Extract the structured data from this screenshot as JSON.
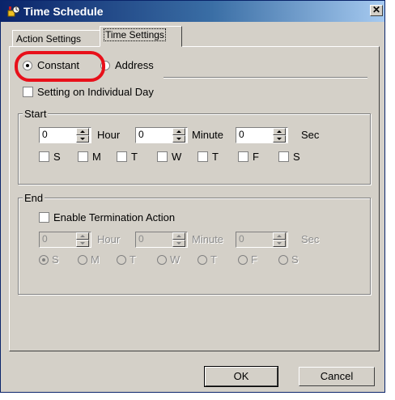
{
  "window": {
    "title": "Time Schedule",
    "close_glyph": "✕"
  },
  "tabs": [
    {
      "label": "Action Settings"
    },
    {
      "label": "Time Settings"
    }
  ],
  "mode": {
    "constant_label": "Constant",
    "address_label": "Address",
    "selected": "Constant"
  },
  "individual_day": {
    "label": "Setting on Individual Day",
    "checked": false
  },
  "start": {
    "group_label": "Start",
    "hour_value": "0",
    "hour_label": "Hour",
    "minute_value": "0",
    "minute_label": "Minute",
    "sec_value": "0",
    "sec_label": "Sec",
    "days": [
      "S",
      "M",
      "T",
      "W",
      "T",
      "F",
      "S"
    ]
  },
  "end": {
    "group_label": "End",
    "enable_label": "Enable Termination Action",
    "enable_checked": false,
    "hour_value": "0",
    "hour_label": "Hour",
    "minute_value": "0",
    "minute_label": "Minute",
    "sec_value": "0",
    "sec_label": "Sec",
    "days": [
      "S",
      "M",
      "T",
      "W",
      "T",
      "F",
      "S"
    ],
    "selected_day_index": 0
  },
  "buttons": {
    "ok": "OK",
    "cancel": "Cancel"
  },
  "colors": {
    "highlight": "#e8101a",
    "titlebar": "#0a246a",
    "dialog_bg": "#d4d0c8"
  },
  "icons": {
    "app": "schedule-app-icon",
    "close": "close-icon"
  }
}
